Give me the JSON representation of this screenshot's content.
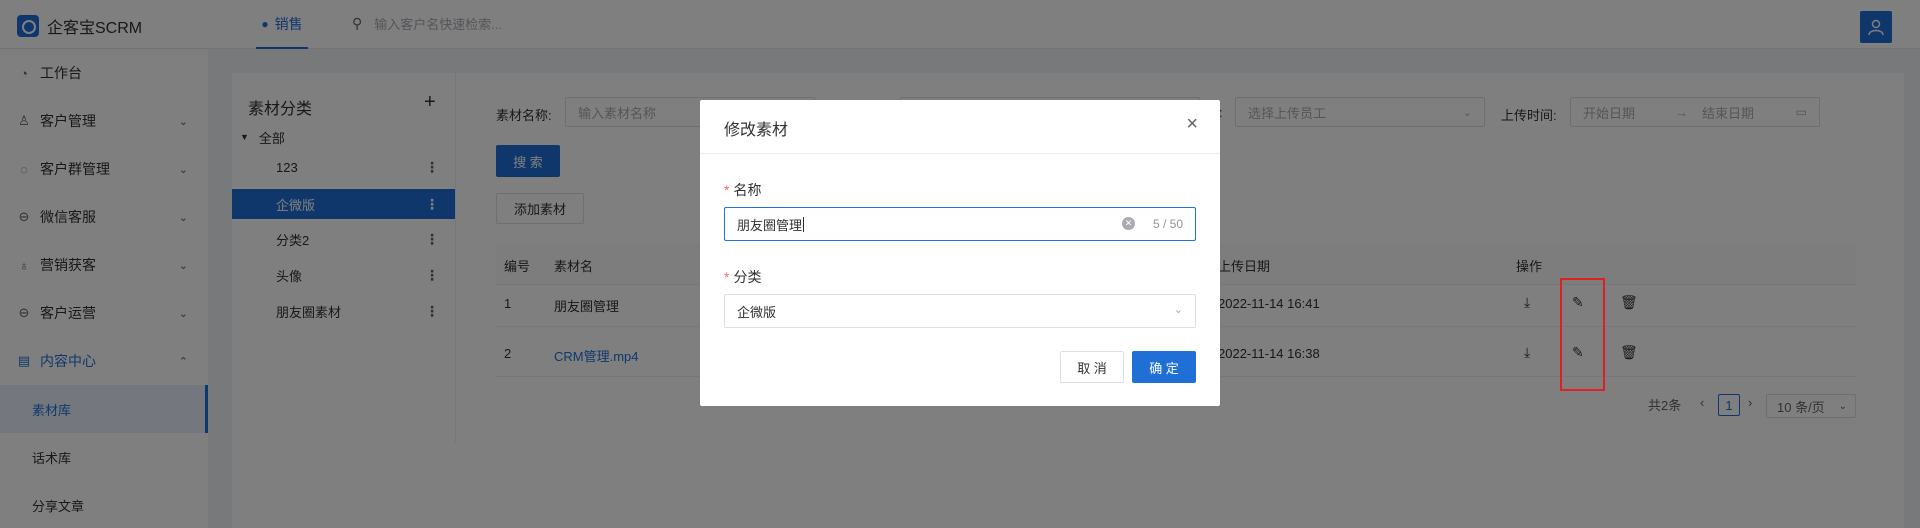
{
  "app": {
    "name": "企客宝SCRM"
  },
  "topnav": {
    "tab_label": "销售",
    "search_placeholder": "输入客户名快速检索..."
  },
  "sidebar": {
    "items": [
      {
        "label": "工作台",
        "icon": "dashboard-icon"
      },
      {
        "label": "客户管理",
        "icon": "user-icon"
      },
      {
        "label": "客户群管理",
        "icon": "chat-icon"
      },
      {
        "label": "微信客服",
        "icon": "service-icon"
      },
      {
        "label": "营销获客",
        "icon": "bulb-icon"
      },
      {
        "label": "客户运营",
        "icon": "operation-icon"
      },
      {
        "label": "内容中心",
        "icon": "content-icon"
      }
    ],
    "sub_items": [
      "素材库",
      "话术库",
      "分享文章"
    ]
  },
  "category_panel": {
    "title": "素材分类",
    "root_label": "全部",
    "categories": [
      "123",
      "企微版",
      "分类2",
      "头像",
      "朋友圈素材"
    ]
  },
  "filters": {
    "name_label": "素材名称:",
    "name_placeholder": "输入素材名称",
    "uploader_label_suffix": ":",
    "uploader_placeholder": "选择上传员工",
    "time_label": "上传时间:",
    "start_placeholder": "开始日期",
    "end_placeholder": "结束日期",
    "range_separator": "→"
  },
  "buttons": {
    "search": "搜 索",
    "add_material": "添加素材"
  },
  "table": {
    "headers": {
      "id": "编号",
      "name": "素材名",
      "upload_date": "上传日期",
      "actions": "操作"
    },
    "rows": [
      {
        "id": "1",
        "name": "朋友圈管理",
        "upload_date": "2022-11-14 16:41"
      },
      {
        "id": "2",
        "name": "CRM管理.mp4",
        "upload_date": "2022-11-14 16:38"
      }
    ]
  },
  "pagination": {
    "total": "共2条",
    "current_page": "1",
    "page_size": "10 条/页"
  },
  "modal": {
    "title": "修改素材",
    "name_label": "名称",
    "name_value": "朋友圈管理",
    "name_count": "5 / 50",
    "category_label": "分类",
    "category_value": "企微版",
    "cancel": "取 消",
    "confirm": "确 定"
  },
  "colors": {
    "primary": "#1f6fd6",
    "highlight_box": "#e02020",
    "required": "#f56c6c"
  }
}
